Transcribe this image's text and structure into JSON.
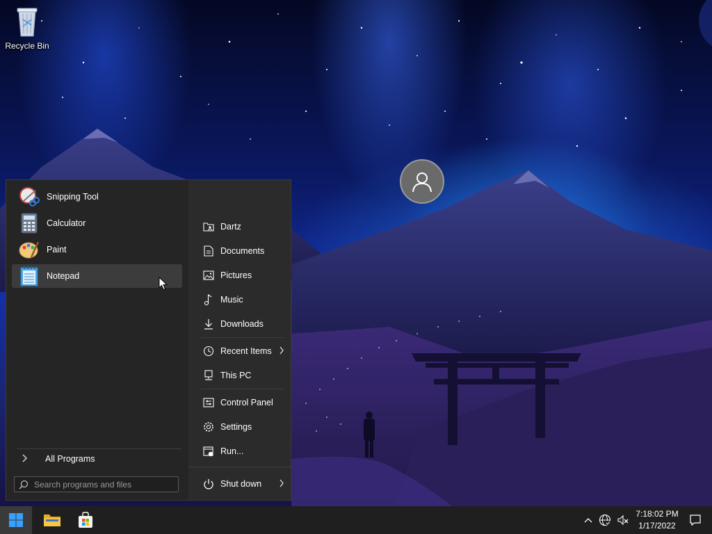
{
  "desktop": {
    "icons": [
      {
        "label": "Recycle Bin",
        "icon": "recycle-bin-icon"
      }
    ]
  },
  "start_menu": {
    "programs": [
      {
        "label": "Snipping Tool",
        "icon": "snipping-tool-icon"
      },
      {
        "label": "Calculator",
        "icon": "calculator-icon"
      },
      {
        "label": "Paint",
        "icon": "paint-icon"
      },
      {
        "label": "Notepad",
        "icon": "notepad-icon",
        "selected": true
      }
    ],
    "all_programs_label": "All Programs",
    "search_placeholder": "Search programs and files",
    "user_avatar": "user-avatar-icon",
    "right_items": [
      {
        "label": "Dartz",
        "icon": "user-folder-icon"
      },
      {
        "label": "Documents",
        "icon": "document-icon"
      },
      {
        "label": "Pictures",
        "icon": "picture-icon"
      },
      {
        "label": "Music",
        "icon": "music-note-icon"
      },
      {
        "label": "Downloads",
        "icon": "download-icon"
      },
      {
        "label": "Recent Items",
        "icon": "clock-icon",
        "has_submenu": true
      },
      {
        "label": "This PC",
        "icon": "computer-icon"
      },
      {
        "label": "Control Panel",
        "icon": "control-panel-icon"
      },
      {
        "label": "Settings",
        "icon": "gear-icon"
      },
      {
        "label": "Run...",
        "icon": "run-icon"
      }
    ],
    "shutdown_label": "Shut down"
  },
  "taskbar": {
    "buttons": [
      {
        "name": "start-button",
        "icon": "windows-logo-icon",
        "active": true
      },
      {
        "name": "file-explorer-button",
        "icon": "folder-icon"
      },
      {
        "name": "store-button",
        "icon": "store-icon"
      }
    ],
    "tray": {
      "time": "7:18:02 PM",
      "date": "1/17/2022"
    }
  },
  "colors": {
    "menu_bg": "#2b2b2b",
    "left_pane_bg": "#252525",
    "taskbar_bg": "#1f1f1f",
    "selected_bg": "#3c3c3c",
    "accent": "#1e90ff"
  }
}
